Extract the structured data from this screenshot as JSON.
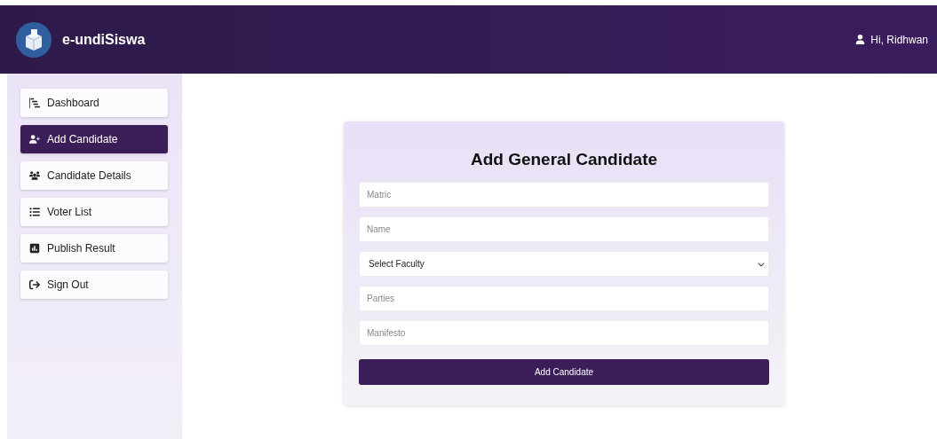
{
  "header": {
    "app_name": "e-undiSiswa",
    "user_greeting": "Hi, Ridhwan"
  },
  "sidebar": {
    "items": [
      {
        "label": "Dashboard",
        "kind": "dashboard",
        "selected": false
      },
      {
        "label": "Add Candidate",
        "kind": "add-user",
        "selected": true
      },
      {
        "label": "Candidate Details",
        "kind": "users",
        "selected": false
      },
      {
        "label": "Voter List",
        "kind": "list",
        "selected": false
      },
      {
        "label": "Publish Result",
        "kind": "result",
        "selected": false
      },
      {
        "label": "Sign Out",
        "kind": "sign-out",
        "selected": false
      }
    ]
  },
  "form": {
    "title": "Add General Candidate",
    "fields": [
      {
        "kind": "text",
        "placeholder": "Matric"
      },
      {
        "kind": "text",
        "placeholder": "Name"
      },
      {
        "kind": "select",
        "value": "Select Faculty"
      },
      {
        "kind": "text",
        "placeholder": "Parties"
      },
      {
        "kind": "text",
        "placeholder": "Manifesto"
      }
    ],
    "submit": "Add Candidate"
  }
}
